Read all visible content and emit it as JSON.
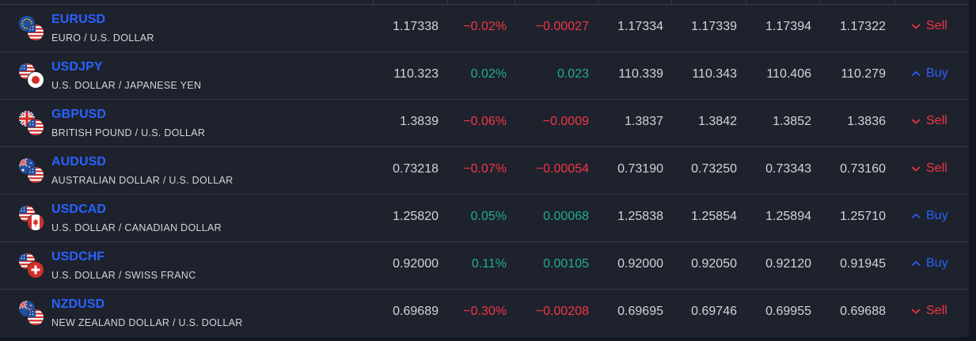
{
  "rows": [
    {
      "symbol": "EURUSD",
      "description": "EURO / U.S. DOLLAR",
      "base_flag": "eu-flag-icon",
      "quote_flag": "us-flag-icon",
      "last": "1.17338",
      "chg_pct": "−0.02%",
      "chg": "−0.00027",
      "bid": "1.17334",
      "ask": "1.17339",
      "high": "1.17394",
      "low": "1.17322",
      "direction": "down",
      "action": "Sell"
    },
    {
      "symbol": "USDJPY",
      "description": "U.S. DOLLAR / JAPANESE YEN",
      "base_flag": "us-flag-icon",
      "quote_flag": "jp-flag-icon",
      "last": "110.323",
      "chg_pct": "0.02%",
      "chg": "0.023",
      "bid": "110.339",
      "ask": "110.343",
      "high": "110.406",
      "low": "110.279",
      "direction": "up",
      "action": "Buy"
    },
    {
      "symbol": "GBPUSD",
      "description": "BRITISH POUND / U.S. DOLLAR",
      "base_flag": "gb-flag-icon",
      "quote_flag": "us-flag-icon",
      "last": "1.3839",
      "chg_pct": "−0.06%",
      "chg": "−0.0009",
      "bid": "1.3837",
      "ask": "1.3842",
      "high": "1.3852",
      "low": "1.3836",
      "direction": "down",
      "action": "Sell"
    },
    {
      "symbol": "AUDUSD",
      "description": "AUSTRALIAN DOLLAR / U.S. DOLLAR",
      "base_flag": "au-flag-icon",
      "quote_flag": "us-flag-icon",
      "last": "0.73218",
      "chg_pct": "−0.07%",
      "chg": "−0.00054",
      "bid": "0.73190",
      "ask": "0.73250",
      "high": "0.73343",
      "low": "0.73160",
      "direction": "down",
      "action": "Sell"
    },
    {
      "symbol": "USDCAD",
      "description": "U.S. DOLLAR / CANADIAN DOLLAR",
      "base_flag": "us-flag-icon",
      "quote_flag": "ca-flag-icon",
      "last": "1.25820",
      "chg_pct": "0.05%",
      "chg": "0.00068",
      "bid": "1.25838",
      "ask": "1.25854",
      "high": "1.25894",
      "low": "1.25710",
      "direction": "up",
      "action": "Buy"
    },
    {
      "symbol": "USDCHF",
      "description": "U.S. DOLLAR / SWISS FRANC",
      "base_flag": "us-flag-icon",
      "quote_flag": "ch-flag-icon",
      "last": "0.92000",
      "chg_pct": "0.11%",
      "chg": "0.00105",
      "bid": "0.92000",
      "ask": "0.92050",
      "high": "0.92120",
      "low": "0.91945",
      "direction": "up",
      "action": "Buy"
    },
    {
      "symbol": "NZDUSD",
      "description": "NEW ZEALAND DOLLAR / U.S. DOLLAR",
      "base_flag": "nz-flag-icon",
      "quote_flag": "us-flag-icon",
      "last": "0.69689",
      "chg_pct": "−0.30%",
      "chg": "−0.00208",
      "bid": "0.69695",
      "ask": "0.69746",
      "high": "0.69955",
      "low": "0.69688",
      "direction": "down",
      "action": "Sell"
    }
  ],
  "colors": {
    "background": "#131722",
    "panel": "#1e222d",
    "border": "#363a45",
    "symbol": "#2962ff",
    "text": "#d1d4dc",
    "negative": "#f23645",
    "positive": "#22ab94",
    "buy": "#2962ff",
    "sell": "#f23645"
  }
}
